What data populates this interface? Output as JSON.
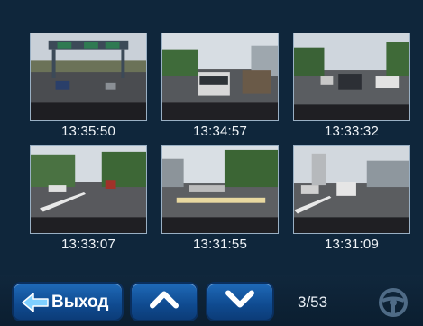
{
  "thumbnails": [
    {
      "time": "13:35:50"
    },
    {
      "time": "13:34:57"
    },
    {
      "time": "13:33:32"
    },
    {
      "time": "13:33:07"
    },
    {
      "time": "13:31:55"
    },
    {
      "time": "13:31:09"
    }
  ],
  "toolbar": {
    "exit_label": "Выход",
    "up_icon": "chevron-up-icon",
    "down_icon": "chevron-down-icon",
    "page_counter": "3/53",
    "steering_icon": "steering-wheel-icon"
  },
  "colors": {
    "background": "#0f263b",
    "button": "#1a5ca6",
    "text": "#ffffff"
  }
}
